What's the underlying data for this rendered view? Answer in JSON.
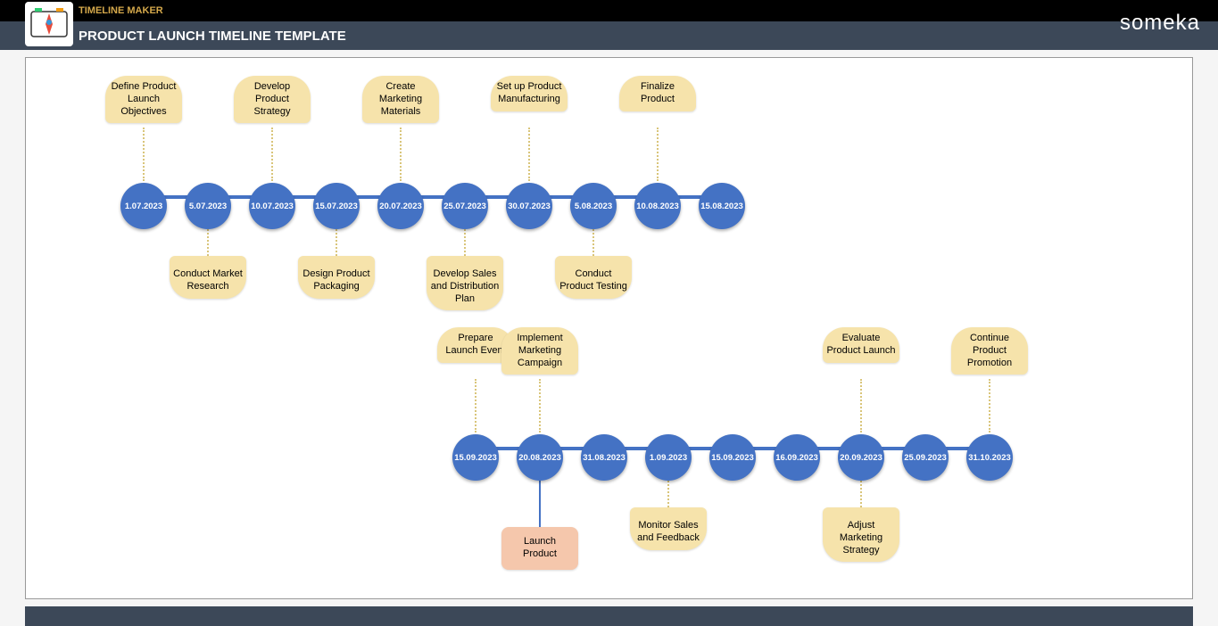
{
  "header": {
    "topTitle": "TIMELINE MAKER",
    "subtitle": "PRODUCT LAUNCH TIMELINE TEMPLATE",
    "brand": "someka"
  },
  "row1": {
    "nodes": [
      {
        "date": "1.07.2023"
      },
      {
        "date": "5.07.2023"
      },
      {
        "date": "10.07.2023"
      },
      {
        "date": "15.07.2023"
      },
      {
        "date": "20.07.2023"
      },
      {
        "date": "25.07.2023"
      },
      {
        "date": "30.07.2023"
      },
      {
        "date": "5.08.2023"
      },
      {
        "date": "10.08.2023"
      },
      {
        "date": "15.08.2023"
      }
    ],
    "calloutsTop": [
      {
        "idx": 1,
        "text": "Define Product Launch Objectives"
      },
      {
        "idx": 3,
        "text": "Develop Product Strategy"
      },
      {
        "idx": 5,
        "text": "Create Marketing Materials"
      },
      {
        "idx": 7,
        "text": "Set up Product Manufacturing"
      },
      {
        "idx": 9,
        "text": "Finalize Product"
      }
    ],
    "calloutsBottom": [
      {
        "idx": 2,
        "text": "Conduct Market Research"
      },
      {
        "idx": 4,
        "text": "Design Product Packaging"
      },
      {
        "idx": 6,
        "text": "Develop Sales and Distribution Plan"
      },
      {
        "idx": 8,
        "text": "Conduct Product Testing"
      }
    ]
  },
  "row2": {
    "nodes": [
      {
        "date": "15.09.2023"
      },
      {
        "date": "20.08.2023"
      },
      {
        "date": "31.08.2023"
      },
      {
        "date": "1.09.2023"
      },
      {
        "date": "15.09.2023"
      },
      {
        "date": "16.09.2023"
      },
      {
        "date": "20.09.2023"
      },
      {
        "date": "25.09.2023"
      },
      {
        "date": "31.10.2023"
      }
    ],
    "calloutsTop": [
      {
        "idx": 1,
        "text": "Prepare Launch Event"
      },
      {
        "idx": 2,
        "text": "Implement Marketing Campaign"
      },
      {
        "idx": 7,
        "text": "Evaluate Product Launch"
      },
      {
        "idx": 9,
        "text": "Continue Product Promotion"
      }
    ],
    "calloutsBottom": [
      {
        "idx": 4,
        "text": "Monitor Sales and Feedback"
      },
      {
        "idx": 7,
        "text": "Adjust Marketing Strategy"
      }
    ],
    "launch": {
      "idx": 2,
      "text": "Launch Product"
    }
  }
}
